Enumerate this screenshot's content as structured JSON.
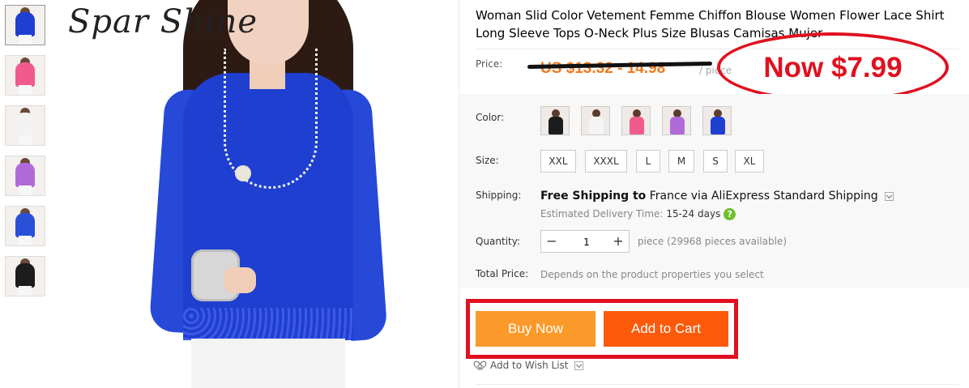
{
  "brand": "Spar Shine",
  "thumbnails": [
    {
      "label": "blue",
      "color": "#1f3fd1"
    },
    {
      "label": "pink",
      "color": "#f05a8c"
    },
    {
      "label": "white",
      "color": "#f2f2f2"
    },
    {
      "label": "purple",
      "color": "#b06ad8"
    },
    {
      "label": "blue",
      "color": "#2a50d8"
    },
    {
      "label": "black",
      "color": "#1c1c1c"
    }
  ],
  "product": {
    "title": "Woman Slid Color Vetement Femme Chiffon Blouse Women Flower Lace Shirt Long Sleeve Tops O-Neck Plus Size Blusas Camisas Mujer"
  },
  "price": {
    "label": "Price:",
    "old": "US $13.32 - 14.98",
    "unit": "/ piece",
    "now": "Now $7.99"
  },
  "color": {
    "label": "Color:",
    "swatches": [
      {
        "name": "black",
        "color": "#1c1c1c"
      },
      {
        "name": "white",
        "color": "#f4f4f4"
      },
      {
        "name": "pink",
        "color": "#f05a8c"
      },
      {
        "name": "purple",
        "color": "#b06ad8"
      },
      {
        "name": "blue",
        "color": "#1f3fd1"
      }
    ]
  },
  "size": {
    "label": "Size:",
    "options": [
      "XXL",
      "XXXL",
      "L",
      "M",
      "S",
      "XL"
    ]
  },
  "shipping": {
    "label": "Shipping:",
    "free": "Free Shipping to",
    "country": "France via",
    "method": "AliExpress Standard Shipping",
    "delivery_label": "Estimated Delivery Time:",
    "delivery_days": "15-24 days",
    "help": "?"
  },
  "quantity": {
    "label": "Quantity:",
    "value": "1",
    "minus": "−",
    "plus": "+",
    "available": "piece (29968 pieces available)"
  },
  "total": {
    "label": "Total Price:",
    "note": "Depends on the product properties you select"
  },
  "actions": {
    "buy_now": "Buy Now",
    "add_to_cart": "Add to Cart",
    "wish_list": "Add to Wish List"
  },
  "colors": {
    "buy_now": "#fb9a2a",
    "add_to_cart": "#fc5a0a",
    "annotation_red": "#e01020",
    "old_price": "#f07a1f"
  }
}
